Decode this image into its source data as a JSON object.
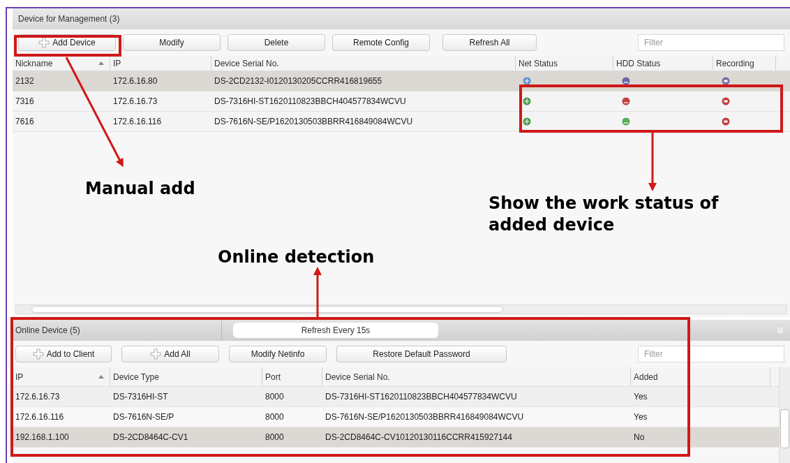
{
  "management": {
    "title": "Device for Management (3)",
    "toolbar": [
      {
        "label": "Add Device",
        "kind": "add"
      },
      {
        "label": "Modify",
        "kind": "plain"
      },
      {
        "label": "Delete",
        "kind": "plain"
      },
      {
        "label": "Remote Config",
        "kind": "plain"
      },
      {
        "label": "Refresh All",
        "kind": "plain"
      }
    ],
    "filter": {
      "placeholder": "Filter"
    },
    "columns": [
      "Nickname",
      "IP",
      "Device Serial No.",
      "Net Status",
      "HDD Status",
      "Recording"
    ],
    "rows": [
      {
        "nickname": "2132",
        "ip": "172.6.16.80",
        "serial": "DS-2CD2132-I0120130205CCRR416819655",
        "selected": true,
        "statuses": [
          {
            "kind": "net",
            "color": "#5b8fd0"
          },
          {
            "kind": "hdd",
            "color": "#6a6aa8"
          },
          {
            "kind": "rec",
            "color": "#7a6aa8"
          }
        ]
      },
      {
        "nickname": "7316",
        "ip": "172.6.16.73",
        "serial": "DS-7316HI-ST1620110823BBCH404577834WCVU",
        "selected": false,
        "statuses": [
          {
            "kind": "net",
            "color": "#4a9a4a"
          },
          {
            "kind": "hdd",
            "color": "#c04040"
          },
          {
            "kind": "rec",
            "color": "#c04040"
          }
        ]
      },
      {
        "nickname": "7616",
        "ip": "172.6.16.116",
        "serial": "DS-7616N-SE/P1620130503BBRR416849084WCVU",
        "selected": false,
        "statuses": [
          {
            "kind": "net",
            "color": "#4a9a4a"
          },
          {
            "kind": "hdd",
            "color": "#5aaa5a"
          },
          {
            "kind": "rec",
            "color": "#c04040"
          }
        ]
      }
    ]
  },
  "online": {
    "title": "Online Device (5)",
    "refresh": "Refresh Every 15s",
    "toolbar": [
      {
        "label": "Add to Client",
        "kind": "add"
      },
      {
        "label": "Add All",
        "kind": "add"
      },
      {
        "label": "Modify Netinfo",
        "kind": "plain"
      },
      {
        "label": "Restore Default Password",
        "kind": "plain"
      }
    ],
    "filter": {
      "placeholder": "Filter"
    },
    "columns": [
      "IP",
      "Device Type",
      "Port",
      "Device Serial No.",
      "Added"
    ],
    "rows": [
      {
        "ip": "172.6.16.73",
        "type": "DS-7316HI-ST",
        "port": "8000",
        "serial": "DS-7316HI-ST1620110823BBCH404577834WCVU",
        "added": "Yes",
        "selected": false
      },
      {
        "ip": "172.6.16.116",
        "type": "DS-7616N-SE/P",
        "port": "8000",
        "serial": "DS-7616N-SE/P1620130503BBRR416849084WCVU",
        "added": "Yes",
        "selected": false
      },
      {
        "ip": "192.168.1.100",
        "type": "DS-2CD8464C-CV1",
        "port": "8000",
        "serial": "DS-2CD8464C-CV10120130116CCRR415927144",
        "added": "No",
        "selected": true
      }
    ]
  },
  "annotations": [
    "Manual add",
    "Show the work status of added device",
    "Online detection"
  ]
}
